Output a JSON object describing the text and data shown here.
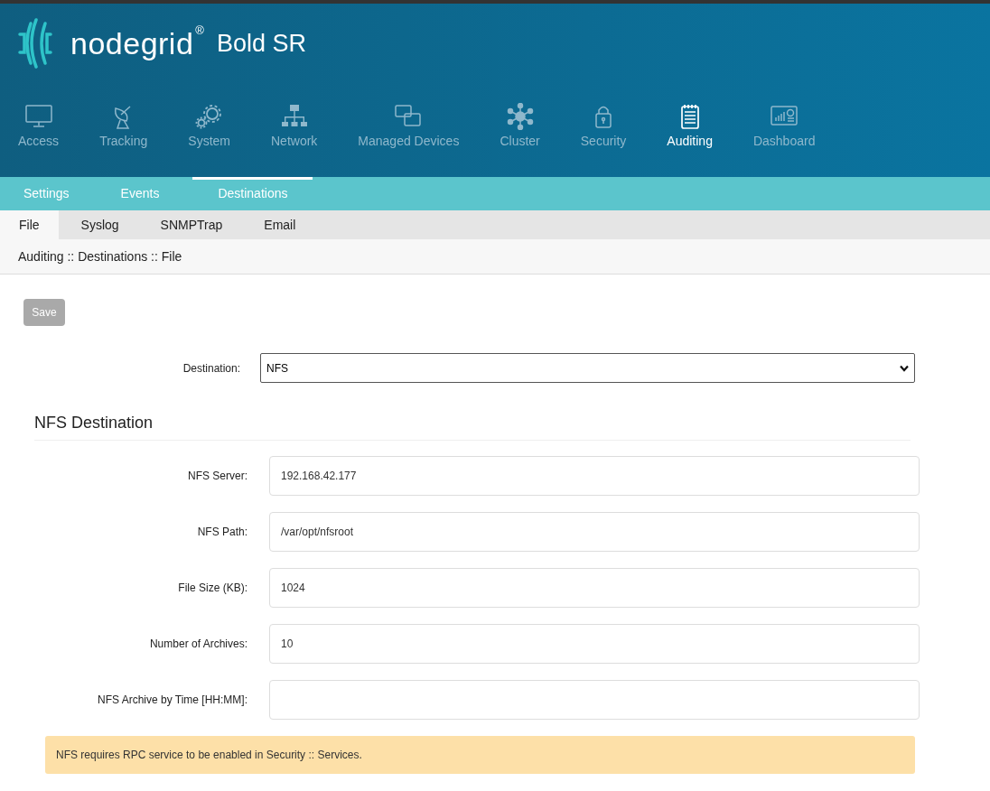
{
  "header": {
    "brand": "nodegrid",
    "registered": "®",
    "product": "Bold SR"
  },
  "nav": [
    {
      "label": "Access",
      "selected": false
    },
    {
      "label": "Tracking",
      "selected": false
    },
    {
      "label": "System",
      "selected": false
    },
    {
      "label": "Network",
      "selected": false
    },
    {
      "label": "Managed Devices",
      "selected": false
    },
    {
      "label": "Cluster",
      "selected": false
    },
    {
      "label": "Security",
      "selected": false
    },
    {
      "label": "Auditing",
      "selected": true
    },
    {
      "label": "Dashboard",
      "selected": false
    }
  ],
  "subnav": [
    {
      "label": "Settings",
      "selected": false
    },
    {
      "label": "Events",
      "selected": false
    },
    {
      "label": "Destinations",
      "selected": true
    }
  ],
  "tabs": [
    {
      "label": "File",
      "selected": true
    },
    {
      "label": "Syslog",
      "selected": false
    },
    {
      "label": "SNMPTrap",
      "selected": false
    },
    {
      "label": "Email",
      "selected": false
    }
  ],
  "breadcrumb": "Auditing :: Destinations :: File",
  "save_button": {
    "label": "Save",
    "disabled": true
  },
  "destination": {
    "label": "Destination:",
    "value": "NFS"
  },
  "section_title": "NFS Destination",
  "fields": [
    {
      "label": "NFS Server:",
      "value": "192.168.42.177"
    },
    {
      "label": "NFS Path:",
      "value": "/var/opt/nfsroot"
    },
    {
      "label": "File Size (KB):",
      "value": "1024"
    },
    {
      "label": "Number of Archives:",
      "value": "10"
    },
    {
      "label": "NFS Archive by Time [HH:MM]:"
    }
  ],
  "alert": "NFS requires RPC service to be enabled in Security :: Services."
}
